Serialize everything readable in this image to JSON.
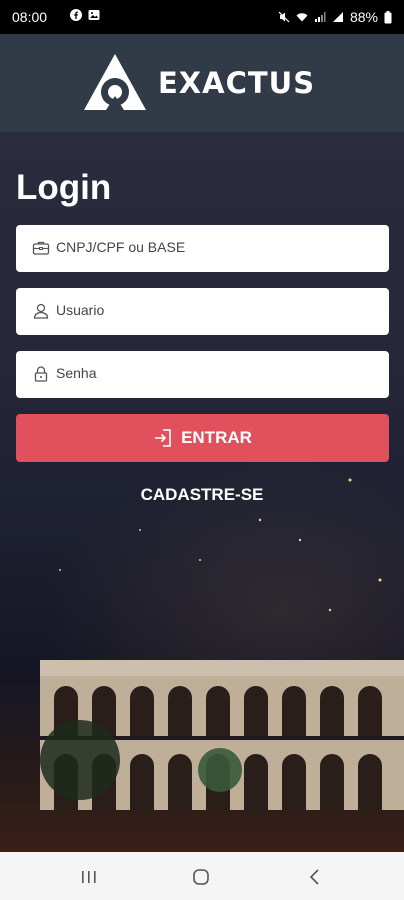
{
  "status_bar": {
    "time": "08:00",
    "battery": "88%"
  },
  "header": {
    "brand": "EXACTUS"
  },
  "login": {
    "title": "Login",
    "cnpj_placeholder": "CNPJ/CPF ou BASE",
    "user_placeholder": "Usuario",
    "password_placeholder": "Senha",
    "submit_label": "ENTRAR",
    "register_label": "CADASTRE-SE"
  },
  "colors": {
    "header_bg": "#303b47",
    "button_bg": "#e3505d",
    "field_bg": "#ffffff"
  },
  "icons": {
    "facebook": "facebook-icon",
    "gallery": "gallery-icon",
    "mute": "mute-icon",
    "wifi": "wifi-icon",
    "signal": "signal-icon",
    "battery": "battery-icon",
    "briefcase": "briefcase-icon",
    "user": "user-icon",
    "lock": "lock-icon",
    "login": "login-icon"
  }
}
